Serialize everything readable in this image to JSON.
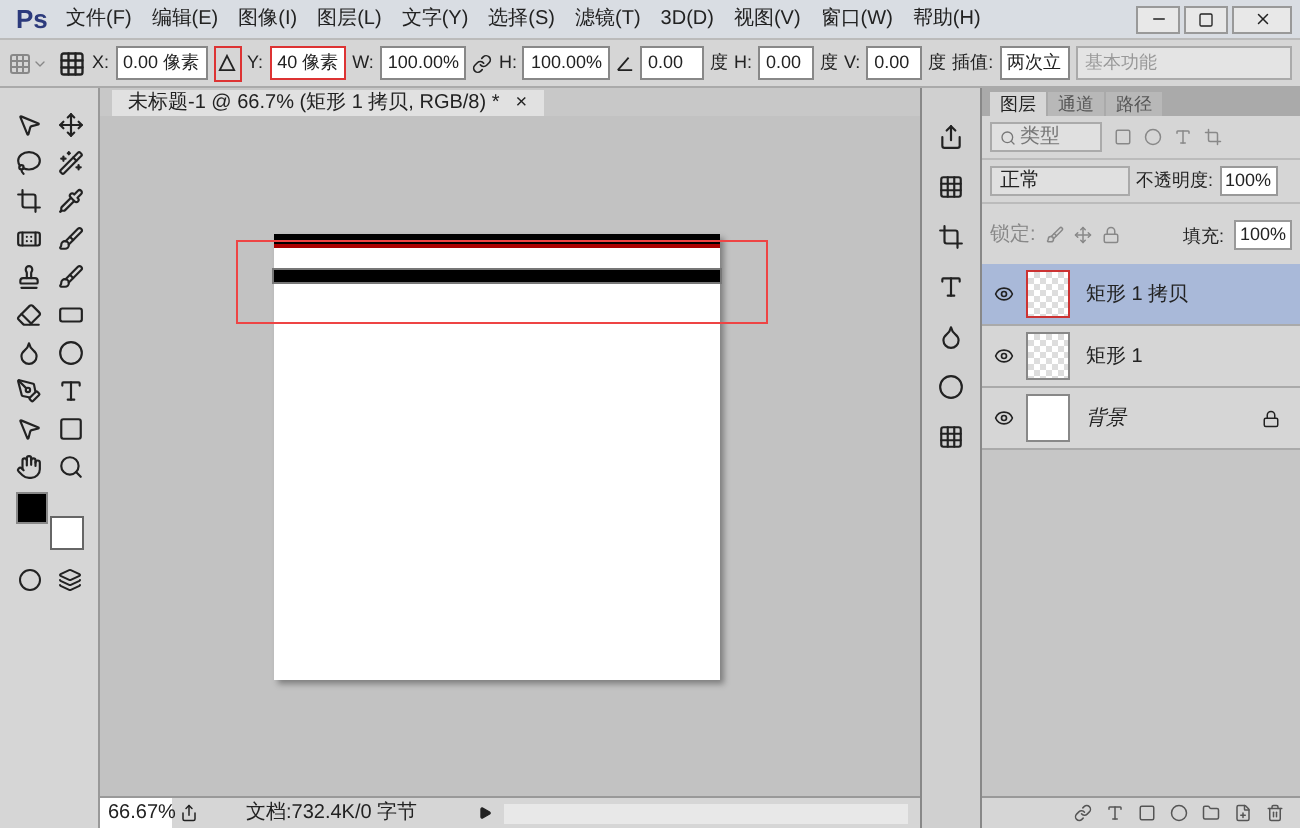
{
  "app_logo": "Ps",
  "menus": [
    {
      "label": "文件(F)"
    },
    {
      "label": "编辑(E)"
    },
    {
      "label": "图像(I)"
    },
    {
      "label": "图层(L)"
    },
    {
      "label": "文字(Y)"
    },
    {
      "label": "选择(S)"
    },
    {
      "label": "滤镜(T)"
    },
    {
      "label": "3D(D)"
    },
    {
      "label": "视图(V)"
    },
    {
      "label": "窗口(W)"
    },
    {
      "label": "帮助(H)"
    }
  ],
  "options_bar": {
    "x": {
      "label": "X:",
      "value": "0.00 像素"
    },
    "y": {
      "label": "Y:",
      "value": "40 像素"
    },
    "w": {
      "label": "W:",
      "value": "100.00%"
    },
    "h": {
      "label": "H:",
      "value": "100.00%"
    },
    "angle": {
      "value": "0.00",
      "unit": "度"
    },
    "skew_h": {
      "label": "H:",
      "value": "0.00",
      "unit": "度"
    },
    "skew_v": {
      "label": "V:",
      "value": "0.00",
      "unit": "度"
    },
    "interpolation": {
      "label": "插值:",
      "value": "两次立"
    },
    "workspace": "基本功能"
  },
  "document_tab": {
    "title": "未标题-1 @ 66.7% (矩形 1 拷贝, RGB/8) *",
    "close": "×"
  },
  "layers_panel": {
    "tabs": [
      {
        "label": "图层",
        "selected": true
      },
      {
        "label": "通道",
        "selected": false
      },
      {
        "label": "路径",
        "selected": false
      }
    ],
    "filter": "类型",
    "blend_mode": "正常",
    "opacity": {
      "label": "不透明度:",
      "value": "100%"
    },
    "lock_label": "锁定:",
    "fill": {
      "label": "填充:",
      "value": "100%"
    },
    "layers": [
      {
        "name": "矩形 1 拷贝",
        "kind": "shape",
        "selected": true,
        "visible": true,
        "locked": false
      },
      {
        "name": "矩形 1",
        "kind": "shape",
        "selected": false,
        "visible": true,
        "locked": false
      },
      {
        "name": "背景",
        "kind": "background",
        "selected": false,
        "visible": true,
        "locked": true
      }
    ]
  },
  "status_bar": {
    "zoom": "66.67%",
    "doc_info": "文档:732.4K/0 字节"
  }
}
